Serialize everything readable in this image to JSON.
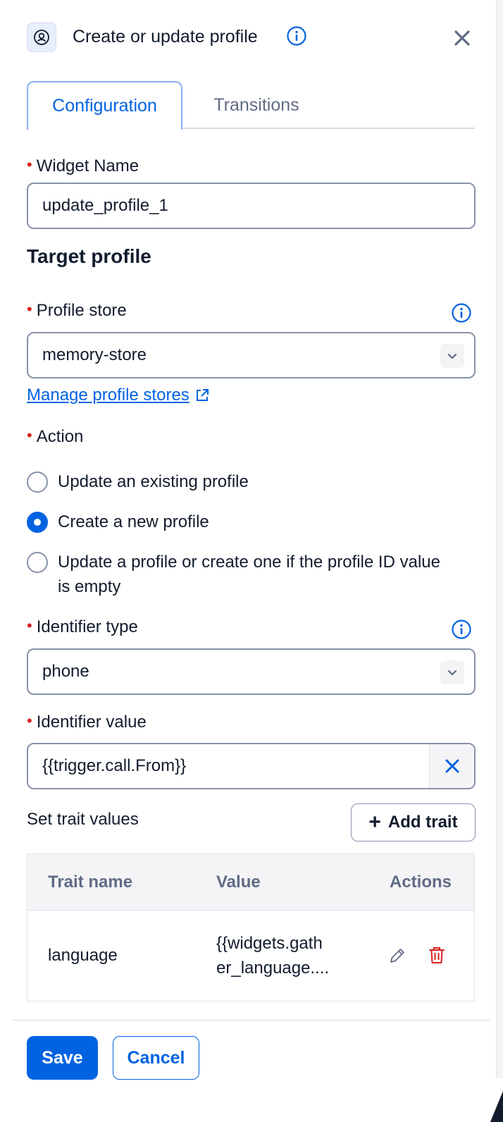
{
  "header": {
    "title": "Create or update profile",
    "icon": "profile-icon",
    "info_icon": "info-icon",
    "close_icon": "close-icon"
  },
  "tabs": [
    {
      "label": "Configuration",
      "active": true
    },
    {
      "label": "Transitions",
      "active": false
    }
  ],
  "widget_name": {
    "label": "Widget Name",
    "value": "update_profile_1"
  },
  "target_profile": {
    "heading": "Target profile"
  },
  "profile_store": {
    "label": "Profile store",
    "value": "memory-store",
    "manage_link": "Manage profile stores"
  },
  "action": {
    "label": "Action",
    "options": [
      {
        "label": "Update an existing profile",
        "checked": false
      },
      {
        "label": "Create a new profile",
        "checked": true
      },
      {
        "label": "Update a profile or create one if the profile ID value is empty",
        "checked": false
      }
    ]
  },
  "identifier_type": {
    "label": "Identifier type",
    "value": "phone"
  },
  "identifier_value": {
    "label": "Identifier value",
    "value": "{{trigger.call.From}}"
  },
  "traits": {
    "label": "Set trait values",
    "add_button": "Add trait",
    "columns": [
      "Trait name",
      "Value",
      "Actions"
    ],
    "rows": [
      {
        "name": "language",
        "value_line1": "{{widgets.gath",
        "value_line2": "er_language...."
      }
    ]
  },
  "footer": {
    "save": "Save",
    "cancel": "Cancel"
  },
  "colors": {
    "primary": "#0263e0",
    "required": "#d61f1f",
    "delete": "#d61f1f"
  }
}
